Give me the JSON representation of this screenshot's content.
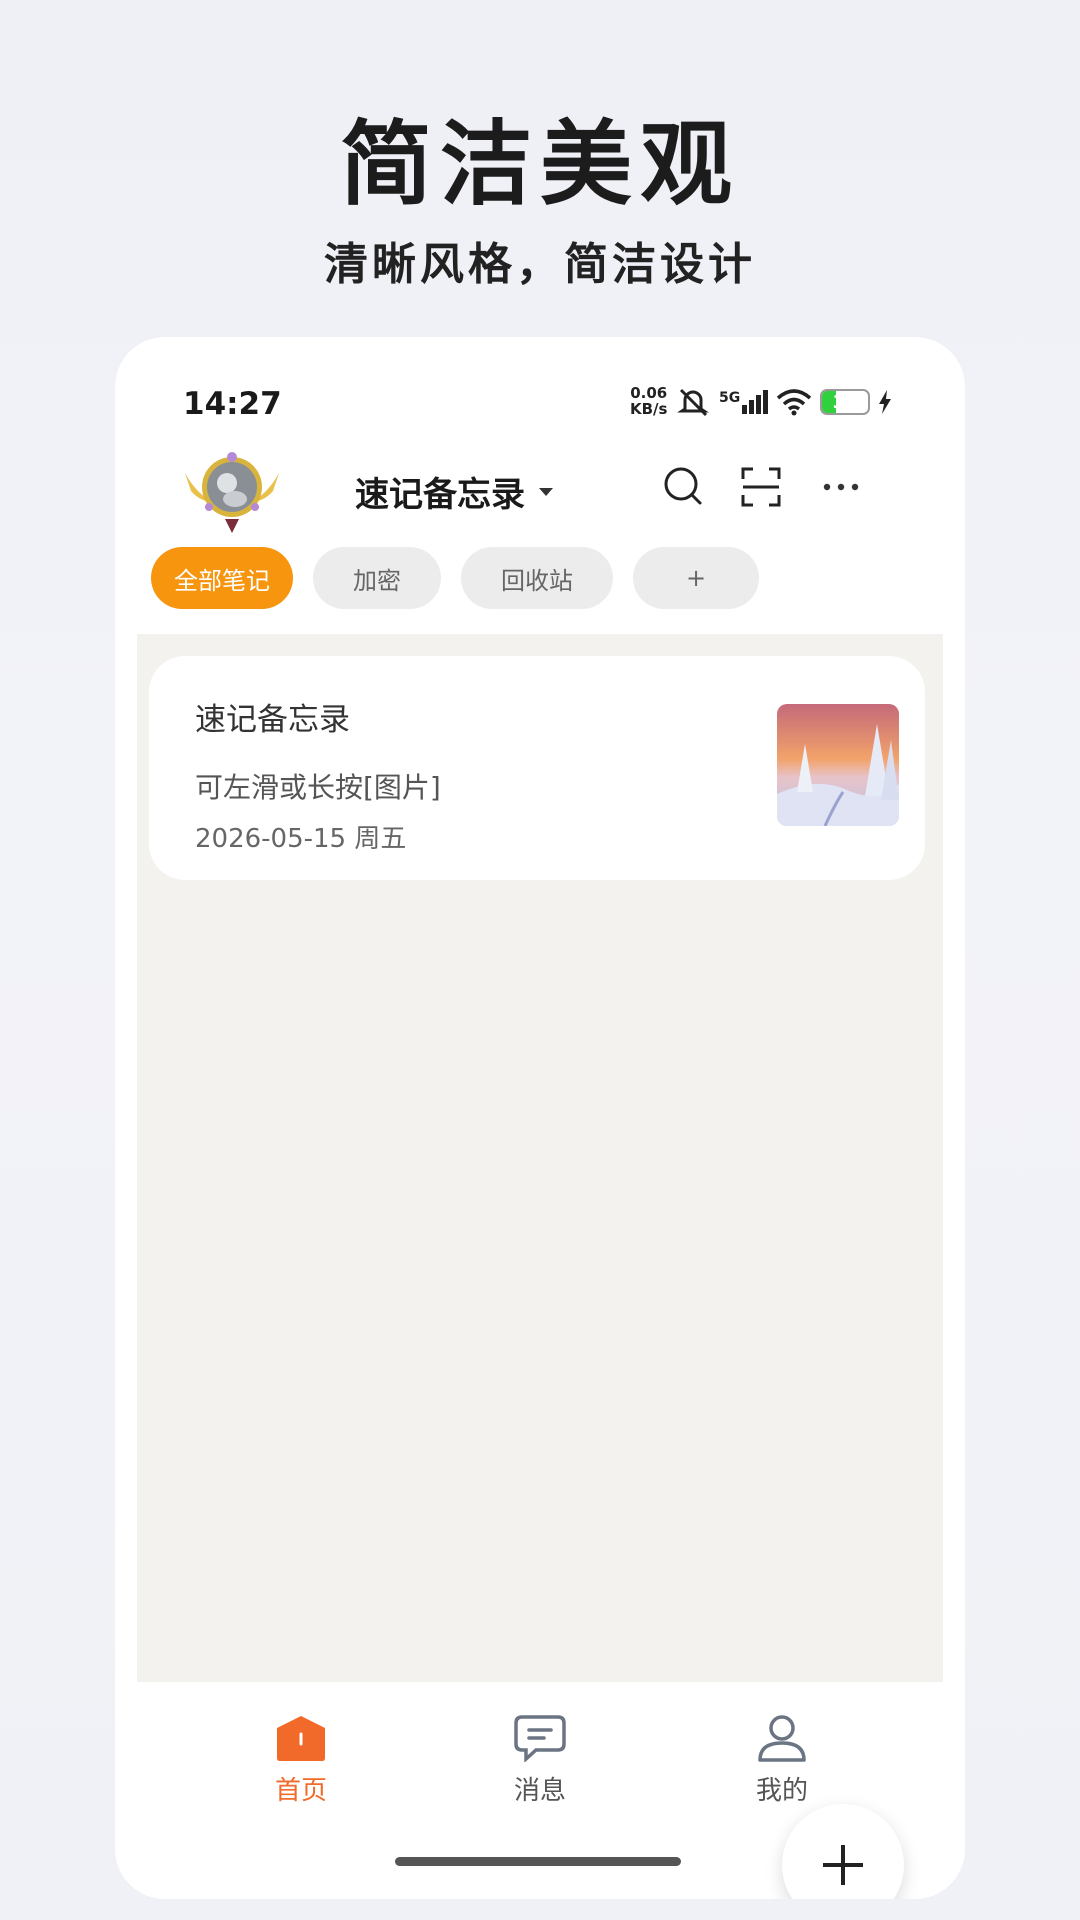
{
  "promo": {
    "title": "简洁美观",
    "subtitle": "清晰风格，简洁设计"
  },
  "status_bar": {
    "time": "14:27",
    "speed_value": "0.06",
    "speed_unit": "KB/s",
    "network": "5G",
    "battery": "30",
    "battery_level": 0.3,
    "battery_color": "#31d03d"
  },
  "header": {
    "app_title": "速记备忘录",
    "icons": [
      "avatar",
      "dropdown-caret-icon",
      "search-icon",
      "scan-icon",
      "more-icon"
    ]
  },
  "chips": [
    {
      "label": "全部笔记",
      "active": true
    },
    {
      "label": "加密",
      "active": false
    },
    {
      "label": "回收站",
      "active": false
    },
    {
      "label": "+",
      "active": false
    }
  ],
  "notes": [
    {
      "title": "速记备忘录",
      "preview": "可左滑或长按[图片]",
      "date": "2026-05-15 周五"
    }
  ],
  "bottom_nav": [
    {
      "label": "首页",
      "icon": "home-icon",
      "active": true
    },
    {
      "label": "消息",
      "icon": "message-icon",
      "active": false
    },
    {
      "label": "我的",
      "icon": "profile-icon",
      "active": false
    }
  ],
  "colors": {
    "accent": "#f7950f",
    "nav_active": "#f26a2a",
    "content_bg": "#f3f2ef"
  }
}
